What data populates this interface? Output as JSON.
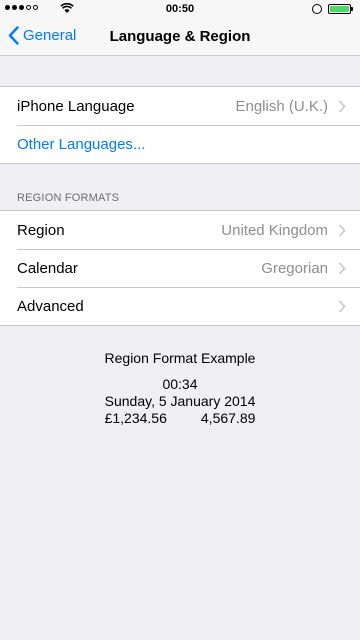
{
  "status_bar": {
    "time": "00:50"
  },
  "nav": {
    "back_label": "General",
    "title": "Language & Region"
  },
  "language_group": {
    "iphone_language_label": "iPhone Language",
    "iphone_language_value": "English (U.K.)",
    "other_languages_label": "Other Languages..."
  },
  "region_formats": {
    "header": "REGION FORMATS",
    "region_label": "Region",
    "region_value": "United Kingdom",
    "calendar_label": "Calendar",
    "calendar_value": "Gregorian",
    "advanced_label": "Advanced"
  },
  "example": {
    "title": "Region Format Example",
    "time": "00:34",
    "date": "Sunday, 5 January 2014",
    "currency": "£1,234.56",
    "number": "4,567.89"
  },
  "colors": {
    "accent": "#007aff",
    "background": "#efeff4",
    "secondary_text": "#8e8e93",
    "battery": "#4cd964"
  }
}
